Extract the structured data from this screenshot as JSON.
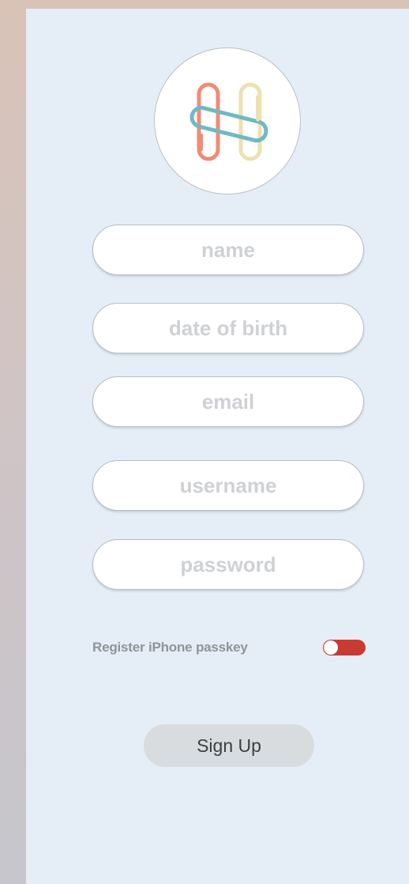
{
  "logo": {
    "icon": "intertwined-loops-logo-icon",
    "colors": {
      "left_loop": "#f28b73",
      "right_loop": "#ece1b0",
      "band": "#6fbac2"
    }
  },
  "form": {
    "fields": [
      {
        "placeholder": "name",
        "value": ""
      },
      {
        "placeholder": "date of birth",
        "value": ""
      },
      {
        "placeholder": "email",
        "value": ""
      },
      {
        "placeholder": "username",
        "value": ""
      },
      {
        "placeholder": "password",
        "value": ""
      }
    ],
    "passkey": {
      "label": "Register iPhone passkey",
      "toggle_color": "#c93a32"
    },
    "submit_label": "Sign Up"
  },
  "colors": {
    "panel": "#e5eef6",
    "button": "#d9dcdf"
  }
}
